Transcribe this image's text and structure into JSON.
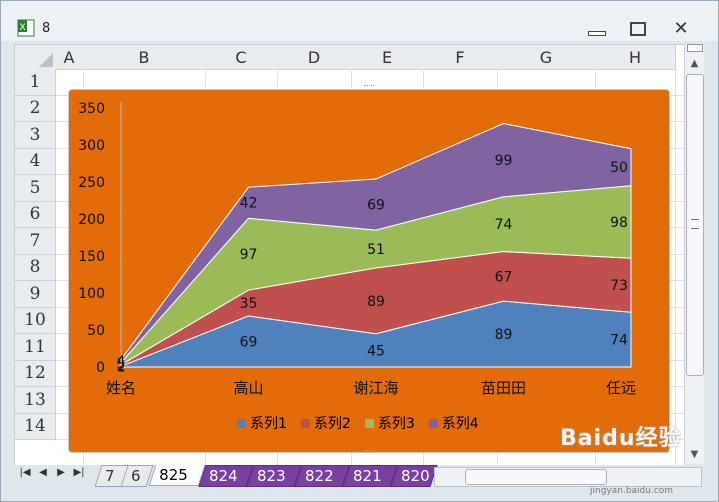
{
  "window": {
    "title": "8"
  },
  "grid": {
    "columns": [
      "A",
      "B",
      "C",
      "D",
      "E",
      "F",
      "G",
      "H"
    ],
    "rows": [
      "1",
      "2",
      "3",
      "4",
      "5",
      "6",
      "7",
      "8",
      "9",
      "10",
      "11",
      "12",
      "13",
      "14"
    ]
  },
  "sheets": {
    "tabs": [
      "7",
      "6",
      "825",
      "824",
      "823",
      "822",
      "821",
      "820"
    ],
    "active": "825"
  },
  "colors": {
    "chart_bg": "#e36c0a",
    "series1": "#4f81bd",
    "series2": "#c0504d",
    "series3": "#9bbb59",
    "series4": "#8064a2",
    "tab_purple": "#7a3fa0"
  },
  "chart_data": {
    "type": "area",
    "stacked": true,
    "categories": [
      "姓名",
      "高山",
      "谢江海",
      "苗田田",
      "任远"
    ],
    "series": [
      {
        "name": "系列1",
        "values": [
          1,
          69,
          45,
          89,
          74
        ]
      },
      {
        "name": "系列2",
        "values": [
          2,
          35,
          89,
          67,
          73
        ]
      },
      {
        "name": "系列3",
        "values": [
          3,
          97,
          51,
          74,
          98
        ]
      },
      {
        "name": "系列4",
        "values": [
          4,
          42,
          69,
          99,
          50
        ]
      }
    ],
    "yticks": [
      "0",
      "50",
      "100",
      "150",
      "200",
      "250",
      "300",
      "350"
    ],
    "ylim": [
      0,
      350
    ],
    "legend_position": "bottom",
    "data_labels": true
  },
  "watermark": {
    "text": "Baidu经验",
    "sub": "jingyan.baidu.com"
  }
}
